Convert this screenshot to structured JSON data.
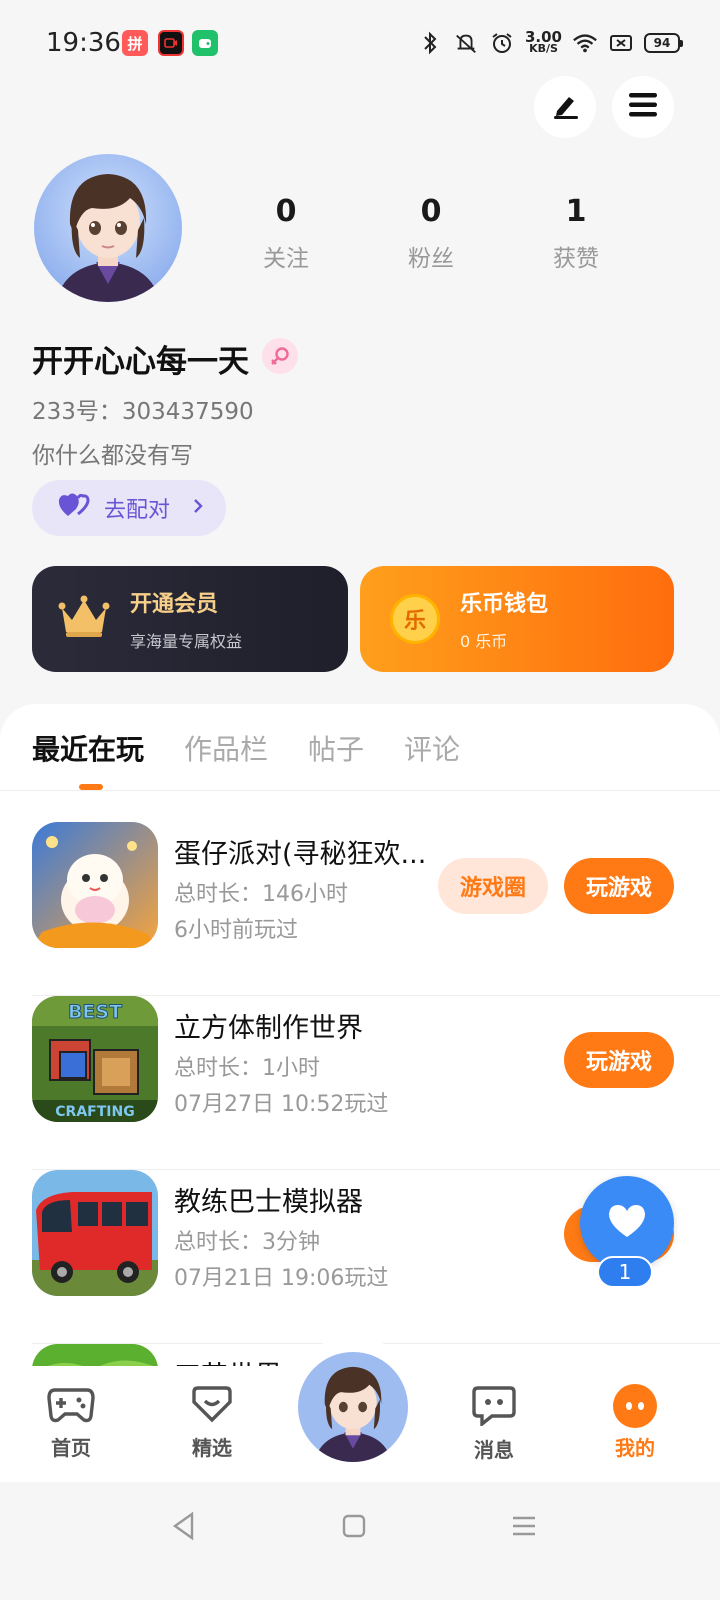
{
  "status_bar": {
    "time": "19:36",
    "net_speed_value": "3.00",
    "net_speed_unit": "KB/S",
    "battery": "94",
    "icons": [
      "bluetooth-icon",
      "mute-icon",
      "alarm-icon",
      "wifi-icon",
      "sim-icon"
    ]
  },
  "header": {
    "icons": [
      "edit-icon",
      "menu-icon"
    ]
  },
  "profile": {
    "stats": [
      {
        "value": "0",
        "label": "关注"
      },
      {
        "value": "0",
        "label": "粉丝"
      },
      {
        "value": "1",
        "label": "获赞"
      }
    ],
    "nickname": "开开心心每一天",
    "user_id": "233号：303437590",
    "bio": "你什么都没有写",
    "match_label": "去配对"
  },
  "cards": {
    "vip": {
      "title": "开通会员",
      "subtitle": "享海量专属权益"
    },
    "wallet": {
      "title": "乐币钱包",
      "subtitle": "0 乐币",
      "coin_glyph": "乐"
    }
  },
  "tabs": [
    {
      "label": "最近在玩",
      "active": true
    },
    {
      "label": "作品栏",
      "active": false
    },
    {
      "label": "帖子",
      "active": false
    },
    {
      "label": "评论",
      "active": false
    }
  ],
  "games": [
    {
      "name": "蛋仔派对(寻秘狂欢...",
      "duration": "总时长：146小时",
      "last_played": "6小时前玩过",
      "circle_label": "游戏圈",
      "play_label": "玩游戏"
    },
    {
      "name": "立方体制作世界",
      "duration": "总时长：1小时",
      "last_played": "07月27日 10:52玩过",
      "play_label": "玩游戏",
      "icon_text_top": "BEST",
      "icon_text_bottom": "CRAFTING"
    },
    {
      "name": "教练巴士模拟器",
      "duration": "总时长：3分钟",
      "last_played": "07月21日 19:06玩过",
      "play_label": "玩游戏"
    },
    {
      "name": "工艺世界"
    }
  ],
  "floating_like": {
    "count": "1"
  },
  "bottom_nav": [
    {
      "label": "首页",
      "icon": "gamepad-icon"
    },
    {
      "label": "精选",
      "icon": "heart-box-icon"
    },
    {
      "label": "",
      "icon": "avatar"
    },
    {
      "label": "消息",
      "icon": "chat-icon"
    },
    {
      "label": "我的",
      "icon": "face-icon",
      "active": true
    }
  ],
  "colors": {
    "accent": "#ff7a15",
    "blue": "#3a8bf5",
    "vip_dark": "#2b2b3a"
  }
}
